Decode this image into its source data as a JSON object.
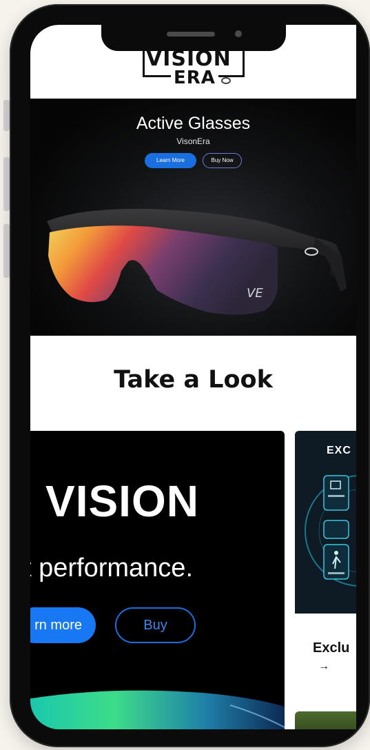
{
  "header": {
    "logo_line1": "VISION",
    "logo_line2": "ERA"
  },
  "hero": {
    "title": "Active Glasses",
    "subtitle": "VisonEra",
    "learn_label": "Learn More",
    "buy_label": "Buy Now",
    "lens_mark": "VE"
  },
  "section": {
    "title": "Take a Look"
  },
  "card1": {
    "headline": "VISION",
    "tagline": "t performance.",
    "learn_label": "rn more",
    "buy_label": "Buy"
  },
  "card2": {
    "title": "EXC",
    "caption": "Exclu",
    "arrow": "→"
  },
  "colors": {
    "accent": "#1877f2",
    "hero_bg": "#0a0a0a",
    "text": "#111111",
    "page_bg": "#f6f2ec"
  }
}
